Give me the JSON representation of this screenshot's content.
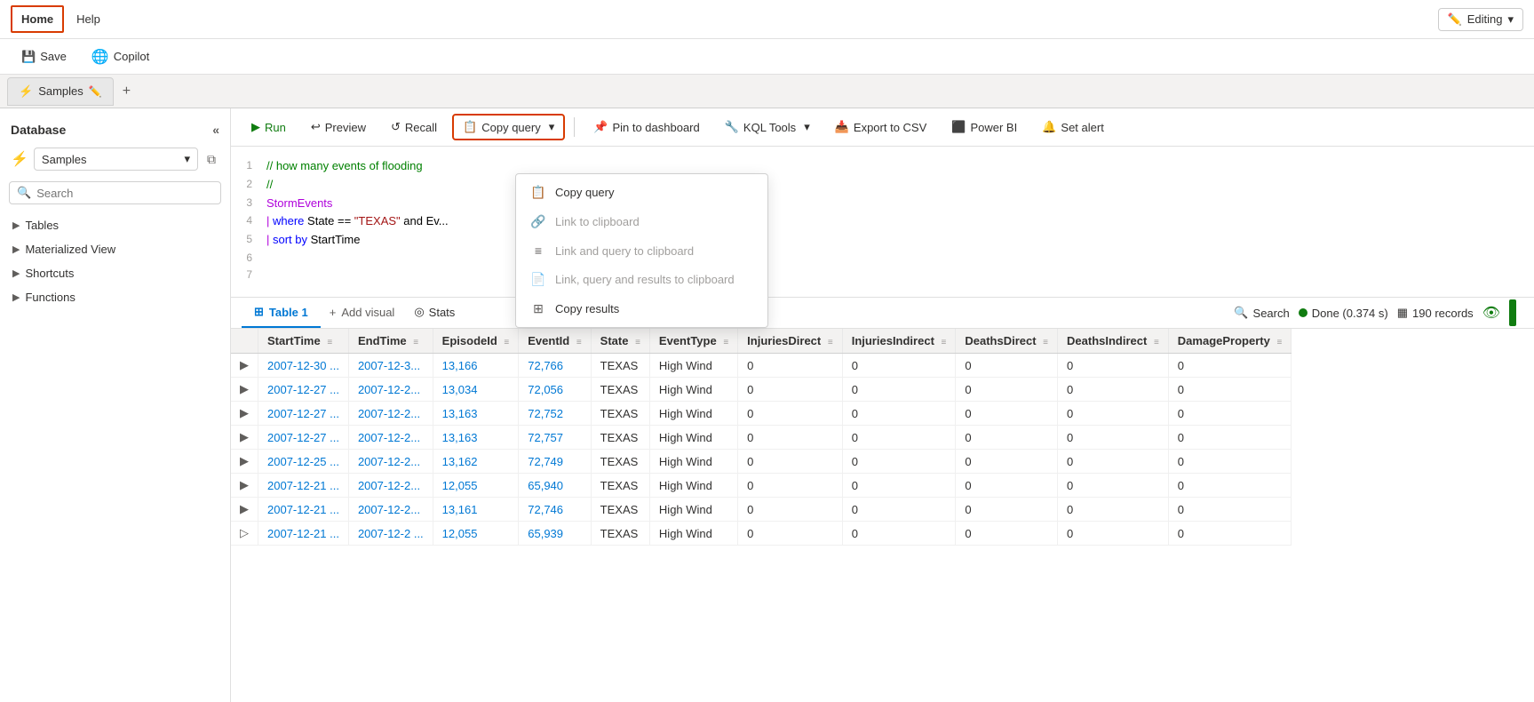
{
  "topbar": {
    "nav": [
      {
        "label": "Home",
        "active": true
      },
      {
        "label": "Help",
        "active": false
      }
    ],
    "editing_label": "Editing",
    "editing_icon": "✏️"
  },
  "secondbar": {
    "save_label": "Save",
    "copilot_label": "Copilot"
  },
  "tabbar": {
    "tabs": [
      {
        "label": "Samples",
        "icon": "⚡"
      }
    ],
    "add_label": "+"
  },
  "sidebar": {
    "title": "Database",
    "collapse_icon": "«",
    "db_name": "Samples",
    "search_placeholder": "Search",
    "tree": [
      {
        "label": "Tables",
        "expandable": true
      },
      {
        "label": "Materialized View",
        "expandable": true
      },
      {
        "label": "Shortcuts",
        "expandable": true
      },
      {
        "label": "Functions",
        "expandable": true
      }
    ]
  },
  "query_toolbar": {
    "run_label": "Run",
    "preview_label": "Preview",
    "recall_label": "Recall",
    "copy_query_label": "Copy query",
    "pin_dashboard_label": "Pin to dashboard",
    "kql_tools_label": "KQL Tools",
    "export_csv_label": "Export to CSV",
    "power_bi_label": "Power BI",
    "set_alert_label": "Set alert"
  },
  "code": {
    "lines": [
      {
        "num": 1,
        "content": "// how many events of flooding ...",
        "type": "comment"
      },
      {
        "num": 2,
        "content": "//",
        "type": "comment"
      },
      {
        "num": 3,
        "content": "StormEvents",
        "type": "keyword"
      },
      {
        "num": 4,
        "content": "| where State == \"TEXAS\" and Ev...",
        "type": "mixed"
      },
      {
        "num": 5,
        "content": "| sort by StartTime",
        "type": "mixed"
      },
      {
        "num": 6,
        "content": "",
        "type": "plain"
      },
      {
        "num": 7,
        "content": "",
        "type": "plain"
      }
    ]
  },
  "dropdown": {
    "items": [
      {
        "label": "Copy query",
        "icon": "📋",
        "disabled": false
      },
      {
        "label": "Link to clipboard",
        "icon": "🔗",
        "disabled": true
      },
      {
        "label": "Link and query to clipboard",
        "icon": "≡",
        "disabled": true
      },
      {
        "label": "Link, query and results to clipboard",
        "icon": "📄",
        "disabled": true
      },
      {
        "label": "Copy results",
        "icon": "⊞",
        "disabled": false
      }
    ]
  },
  "results": {
    "tabs": [
      {
        "label": "Table 1",
        "active": true,
        "icon": "⊞"
      },
      {
        "label": "Add visual",
        "icon": "+"
      },
      {
        "label": "Stats",
        "icon": "◎"
      }
    ],
    "status": {
      "done_label": "Done (0.374 s)",
      "records_label": "190 records"
    },
    "search_label": "Search",
    "columns": [
      "",
      "StartTime",
      "EndTime",
      "EpisodeId",
      "EventId",
      "State",
      "EventType",
      "InjuriesDirect",
      "InjuriesIndirect",
      "DeathsDirect",
      "DeathsIndirect",
      "DamageProperty"
    ],
    "rows": [
      {
        "expand": "▶",
        "StartTime": "2007-12-30 ...",
        "EndTime": "2007-12-3...",
        "EpisodeId": "13,166",
        "EventId": "72,766",
        "State": "TEXAS",
        "EventType": "High Wind",
        "InjuriesDirect": "0",
        "InjuriesIndirect": "0",
        "DeathsDirect": "0",
        "DeathsIndirect": "0",
        "DamageProperty": "0"
      },
      {
        "expand": "▶",
        "StartTime": "2007-12-27 ...",
        "EndTime": "2007-12-2...",
        "EpisodeId": "13,034",
        "EventId": "72,056",
        "State": "TEXAS",
        "EventType": "High Wind",
        "InjuriesDirect": "0",
        "InjuriesIndirect": "0",
        "DeathsDirect": "0",
        "DeathsIndirect": "0",
        "DamageProperty": "0"
      },
      {
        "expand": "▶",
        "StartTime": "2007-12-27 ...",
        "EndTime": "2007-12-2...",
        "EpisodeId": "13,163",
        "EventId": "72,752",
        "State": "TEXAS",
        "EventType": "High Wind",
        "InjuriesDirect": "0",
        "InjuriesIndirect": "0",
        "DeathsDirect": "0",
        "DeathsIndirect": "0",
        "DamageProperty": "0"
      },
      {
        "expand": "▶",
        "StartTime": "2007-12-27 ...",
        "EndTime": "2007-12-2...",
        "EpisodeId": "13,163",
        "EventId": "72,757",
        "State": "TEXAS",
        "EventType": "High Wind",
        "InjuriesDirect": "0",
        "InjuriesIndirect": "0",
        "DeathsDirect": "0",
        "DeathsIndirect": "0",
        "DamageProperty": "0"
      },
      {
        "expand": "▶",
        "StartTime": "2007-12-25 ...",
        "EndTime": "2007-12-2...",
        "EpisodeId": "13,162",
        "EventId": "72,749",
        "State": "TEXAS",
        "EventType": "High Wind",
        "InjuriesDirect": "0",
        "InjuriesIndirect": "0",
        "DeathsDirect": "0",
        "DeathsIndirect": "0",
        "DamageProperty": "0"
      },
      {
        "expand": "▶",
        "StartTime": "2007-12-21 ...",
        "EndTime": "2007-12-2...",
        "EpisodeId": "12,055",
        "EventId": "65,940",
        "State": "TEXAS",
        "EventType": "High Wind",
        "InjuriesDirect": "0",
        "InjuriesIndirect": "0",
        "DeathsDirect": "0",
        "DeathsIndirect": "0",
        "DamageProperty": "0"
      },
      {
        "expand": "▶",
        "StartTime": "2007-12-21 ...",
        "EndTime": "2007-12-2...",
        "EpisodeId": "13,161",
        "EventId": "72,746",
        "State": "TEXAS",
        "EventType": "High Wind",
        "InjuriesDirect": "0",
        "InjuriesIndirect": "0",
        "DeathsDirect": "0",
        "DeathsIndirect": "0",
        "DamageProperty": "0"
      },
      {
        "expand": "▷",
        "StartTime": "2007-12-21 ...",
        "EndTime": "2007-12-2 ...",
        "EpisodeId": "12,055",
        "EventId": "65,939",
        "State": "TEXAS",
        "EventType": "High Wind",
        "InjuriesDirect": "0",
        "InjuriesIndirect": "0",
        "DeathsDirect": "0",
        "DeathsIndirect": "0",
        "DamageProperty": "0"
      }
    ]
  }
}
